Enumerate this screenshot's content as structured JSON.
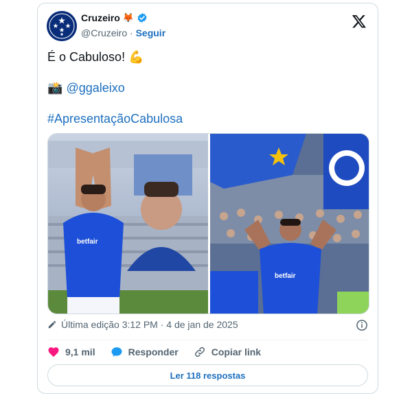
{
  "account": {
    "name": "Cruzeiro",
    "name_emoji": "🦊",
    "handle": "@Cruzeiro",
    "separator": "·",
    "follow_label": "Seguir"
  },
  "tweet": {
    "text": "É o Cabuloso! 💪",
    "camera_emoji": "📸",
    "mention": "@ggaleixo",
    "hashtag": "#ApresentaçãoCabulosa"
  },
  "media": {
    "photos": [
      {
        "icon": "player-crossed-arms-photo"
      },
      {
        "icon": "player-flexing-crowd-photo"
      }
    ],
    "sponsor_text": "betfair"
  },
  "meta": {
    "edited_label": "Última edição 3:12 PM · 4 de jan de 2025"
  },
  "actions": {
    "likes": "9,1 mil",
    "reply_label": "Responder",
    "copy_label": "Copiar link"
  },
  "read_replies_label": "Ler 118 respostas",
  "colors": {
    "brand_blue": "#1d6fbf",
    "like_pink": "#f91880",
    "reply_blue": "#1d9bf0",
    "verified_blue": "#1d9bf0"
  }
}
